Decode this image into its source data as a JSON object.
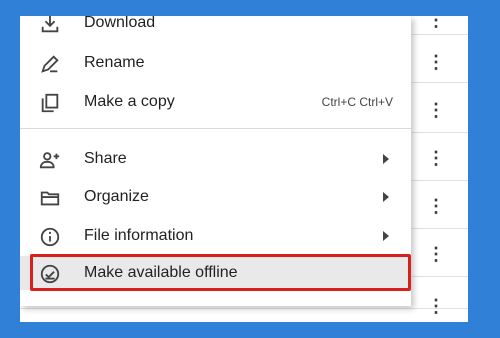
{
  "menu": {
    "items": [
      {
        "label": "Download",
        "icon": "download-icon"
      },
      {
        "label": "Rename",
        "icon": "pencil-icon"
      },
      {
        "label": "Make a copy",
        "icon": "copy-icon",
        "shortcut": "Ctrl+C Ctrl+V"
      },
      {
        "label": "Share",
        "icon": "add-person-icon",
        "submenu": true
      },
      {
        "label": "Organize",
        "icon": "folder-icon",
        "submenu": true
      },
      {
        "label": "File information",
        "icon": "info-icon",
        "submenu": true
      },
      {
        "label": "Make available offline",
        "icon": "offline-check-icon",
        "highlighted": true
      }
    ]
  },
  "row_actions": {
    "more_icon": "more-vert-icon",
    "glyph": "⋮"
  },
  "colors": {
    "background": "#2f80d6",
    "highlight_border": "#d9201f",
    "hover_fill": "#e9e9e9"
  }
}
